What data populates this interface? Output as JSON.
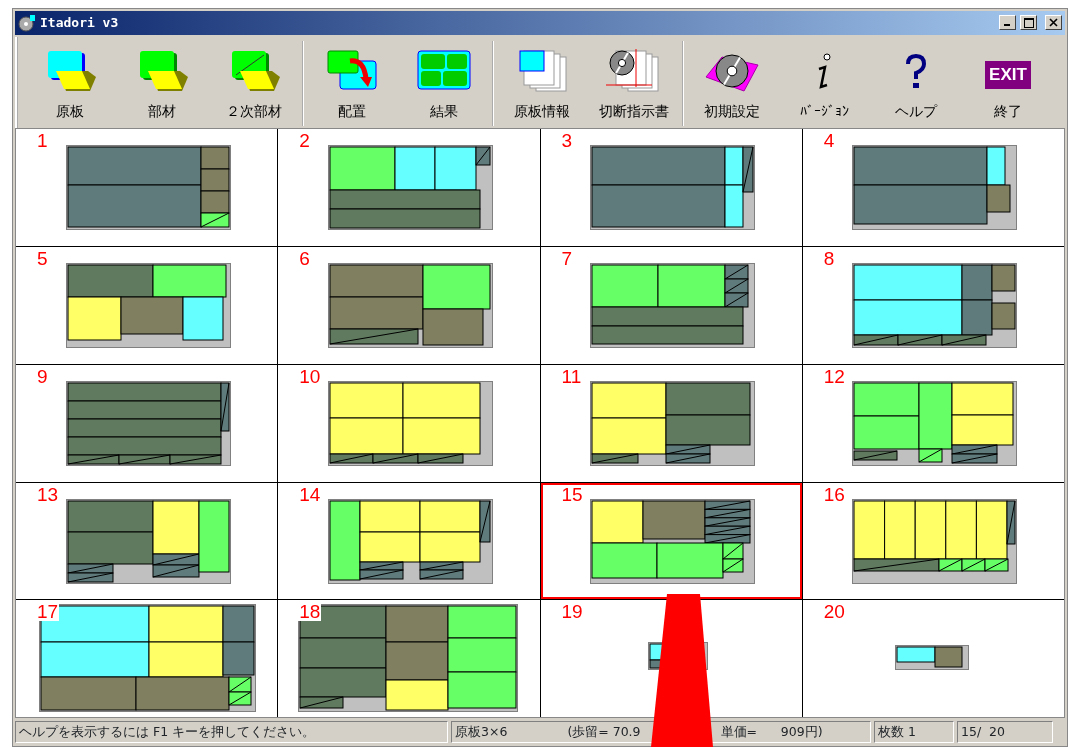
{
  "window": {
    "title": "Itadori v3"
  },
  "toolbar": {
    "groups": [
      {
        "buttons": [
          {
            "label": "原板"
          },
          {
            "label": "部材"
          },
          {
            "label": "２次部材"
          }
        ]
      },
      {
        "buttons": [
          {
            "label": "配置"
          },
          {
            "label": "結果"
          }
        ]
      },
      {
        "buttons": [
          {
            "label": "原板情報"
          },
          {
            "label": "切断指示書"
          }
        ]
      },
      {
        "buttons": [
          {
            "label": "初期設定"
          },
          {
            "label": "ﾊﾞｰｼﾞｮﾝ"
          },
          {
            "label": "ヘルプ"
          },
          {
            "label": "終了",
            "icon_text": "EXIT"
          }
        ]
      }
    ]
  },
  "layouts": [
    {
      "number": "1",
      "selected": false
    },
    {
      "number": "2",
      "selected": false
    },
    {
      "number": "3",
      "selected": false
    },
    {
      "number": "4",
      "selected": false
    },
    {
      "number": "5",
      "selected": false
    },
    {
      "number": "6",
      "selected": false
    },
    {
      "number": "7",
      "selected": false
    },
    {
      "number": "8",
      "selected": false
    },
    {
      "number": "9",
      "selected": false
    },
    {
      "number": "10",
      "selected": false
    },
    {
      "number": "11",
      "selected": false
    },
    {
      "number": "12",
      "selected": false
    },
    {
      "number": "13",
      "selected": false
    },
    {
      "number": "14",
      "selected": false
    },
    {
      "number": "15",
      "selected": true
    },
    {
      "number": "16",
      "selected": false
    },
    {
      "number": "17",
      "selected": false
    },
    {
      "number": "18",
      "selected": false
    },
    {
      "number": "19",
      "selected": false
    },
    {
      "number": "20",
      "selected": false
    }
  ],
  "status_bar": {
    "help": "ヘルプを表示するには F1 キーを押してください。",
    "board": "原板3×6",
    "yield": "(歩留= 70.9",
    "price": "単価=      909円)",
    "count": "枚数 1",
    "page": "15/  20"
  }
}
